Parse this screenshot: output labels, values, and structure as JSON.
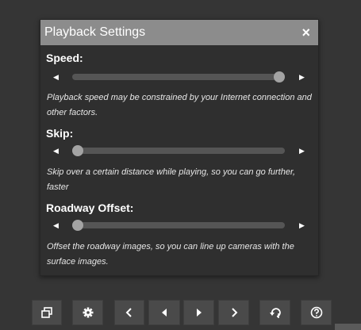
{
  "dialog": {
    "title": "Playback Settings",
    "close_glyph": "×"
  },
  "settings": [
    {
      "label": "Speed:",
      "value_fraction": 1.0,
      "description": "Playback speed may be constrained by your Internet connection and other factors."
    },
    {
      "label": "Skip:",
      "value_fraction": 0.0,
      "description": "Skip over a certain distance while playing, so you can go further, faster"
    },
    {
      "label": "Roadway Offset:",
      "value_fraction": 0.0,
      "description": "Offset the roadway images, so you can line up cameras with the surface images."
    }
  ],
  "toolbar": {
    "icons": [
      "window-icon",
      "gear-icon",
      "chevron-left-icon",
      "step-back-icon",
      "play-icon",
      "chevron-right-icon",
      "reverse-icon",
      "help-icon"
    ]
  },
  "colors": {
    "background": "#353535",
    "titlebar": "#8c8c8c",
    "slider_track": "#555555",
    "slider_thumb": "#a3a3a3",
    "button": "#4a4a4a"
  }
}
